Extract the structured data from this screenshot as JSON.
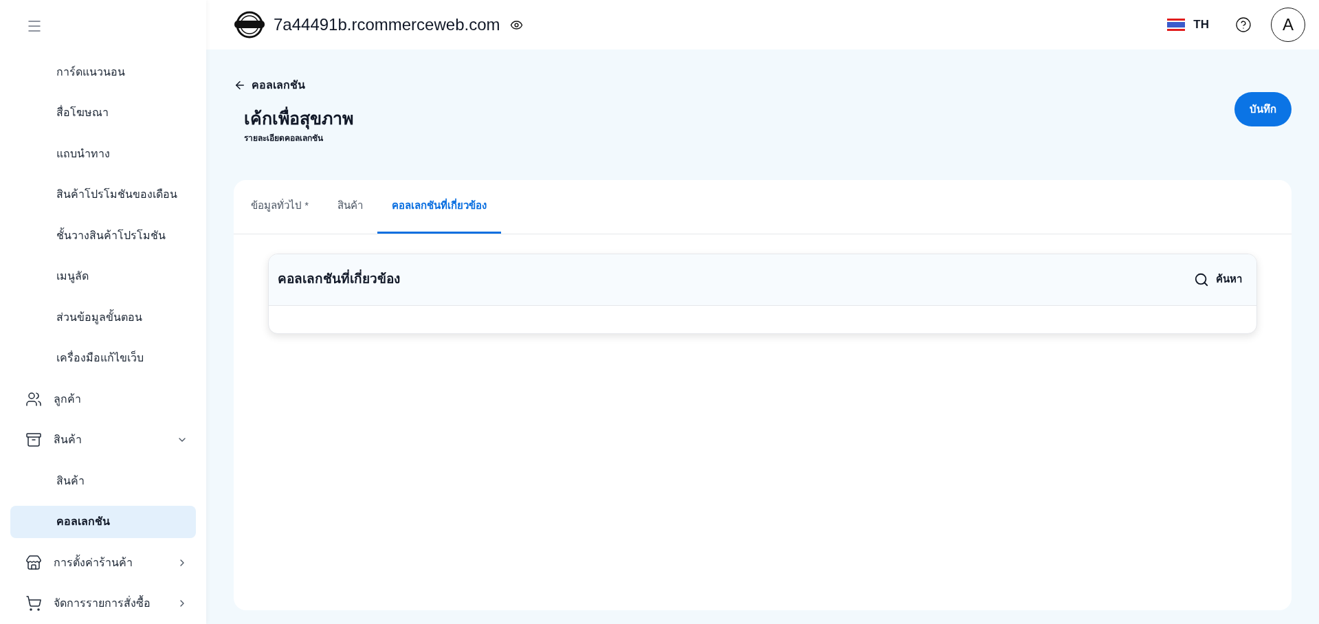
{
  "header": {
    "site": "7a44491b.rcommerceweb.com",
    "language": "TH",
    "avatar": "A"
  },
  "sidebar": {
    "items": [
      {
        "kind": "sub",
        "label": "การ์ดแนวนอน",
        "selected": false
      },
      {
        "kind": "sub",
        "label": "สื่อโฆษณา",
        "selected": false
      },
      {
        "kind": "sub",
        "label": "แถบนำทาง",
        "selected": false
      },
      {
        "kind": "sub",
        "label": "สินค้าโปรโมชันของเดือน",
        "selected": false
      },
      {
        "kind": "sub",
        "label": "ชั้นวางสินค้าโปรโมชัน",
        "selected": false
      },
      {
        "kind": "sub",
        "label": "เมนูลัด",
        "selected": false
      },
      {
        "kind": "sub",
        "label": "ส่วนข้อมูลขั้นตอน",
        "selected": false
      },
      {
        "kind": "sub",
        "label": "เครื่องมือแก้ไขเว็บ",
        "selected": false
      },
      {
        "kind": "link",
        "label": "ลูกค้า"
      },
      {
        "kind": "group",
        "label": "สินค้า",
        "expanded": true,
        "children": [
          {
            "label": "สินค้า",
            "selected": false
          },
          {
            "label": "คอลเลกชัน",
            "selected": true
          }
        ]
      },
      {
        "kind": "group",
        "label": "การตั้งค่าร้านค้า",
        "expanded": false
      },
      {
        "kind": "group",
        "label": "จัดการรายการสั่งซื้อ",
        "expanded": false
      }
    ]
  },
  "page": {
    "back": "คอลเลกชัน",
    "title": "เค้กเพื่อสุขภาพ",
    "subtitle": "รายละเอียดคอลเลกชัน",
    "save": "บันทึก"
  },
  "tabs": [
    {
      "label": "ข้อมูลทั่วไป *",
      "selected": false
    },
    {
      "label": "สินค้า",
      "selected": false
    },
    {
      "label": "คอลเลกชันที่เกี่ยวข้อง",
      "selected": true
    }
  ],
  "panel": {
    "title": "คอลเลกชันที่เกี่ยวข้อง",
    "search": "ค้นหา"
  }
}
